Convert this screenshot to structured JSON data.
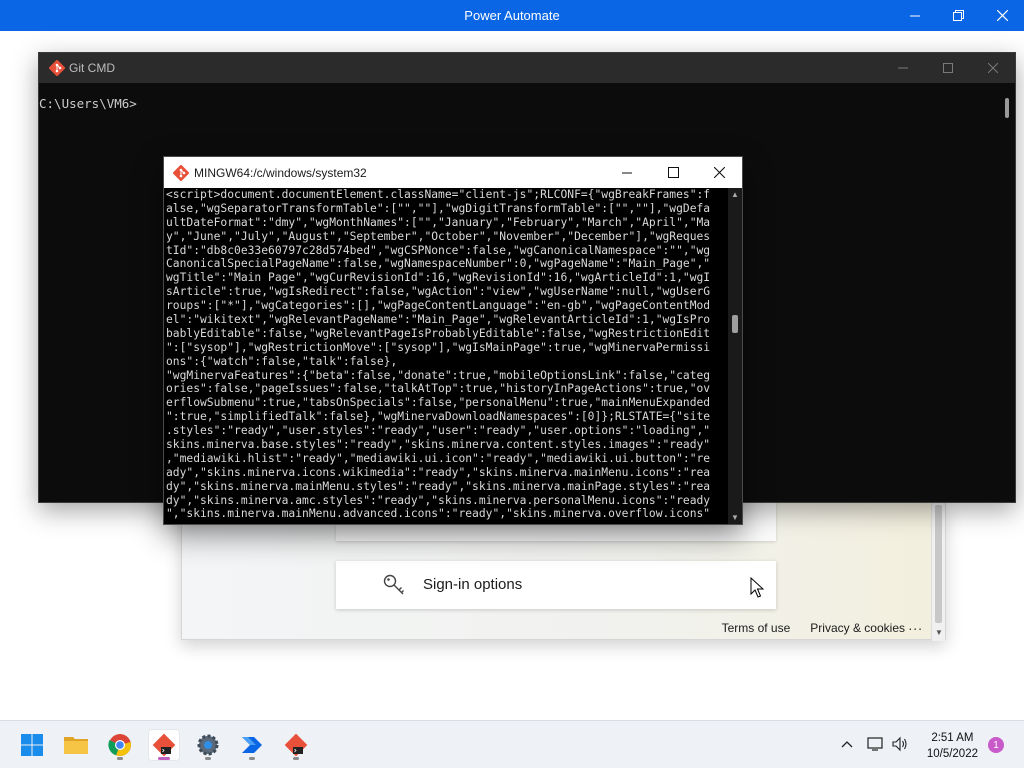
{
  "power_automate": {
    "title": "Power Automate"
  },
  "signin": {
    "options_label": "Sign-in options",
    "footer": {
      "terms": "Terms of use",
      "privacy": "Privacy & cookies",
      "more": "..."
    }
  },
  "gitcmd": {
    "title": "Git CMD",
    "prompt": "C:\\Users\\VM6>"
  },
  "mingw": {
    "title": "MINGW64:/c/windows/system32",
    "lines": [
      "<script>document.documentElement.className=\"client-js\";RLCONF={\"wgBreakFrames\":f",
      "alse,\"wgSeparatorTransformTable\":[\"\",\"\"],\"wgDigitTransformTable\":[\"\",\"\"],\"wgDefa",
      "ultDateFormat\":\"dmy\",\"wgMonthNames\":[\"\",\"January\",\"February\",\"March\",\"April\",\"Ma",
      "y\",\"June\",\"July\",\"August\",\"September\",\"October\",\"November\",\"December\"],\"wgReques",
      "tId\":\"db8c0e33e60797c28d574bed\",\"wgCSPNonce\":false,\"wgCanonicalNamespace\":\"\",\"wg",
      "CanonicalSpecialPageName\":false,\"wgNamespaceNumber\":0,\"wgPageName\":\"Main_Page\",\"",
      "wgTitle\":\"Main Page\",\"wgCurRevisionId\":16,\"wgRevisionId\":16,\"wgArticleId\":1,\"wgI",
      "sArticle\":true,\"wgIsRedirect\":false,\"wgAction\":\"view\",\"wgUserName\":null,\"wgUserG",
      "roups\":[\"*\"],\"wgCategories\":[],\"wgPageContentLanguage\":\"en-gb\",\"wgPageContentMod",
      "el\":\"wikitext\",\"wgRelevantPageName\":\"Main_Page\",\"wgRelevantArticleId\":1,\"wgIsPro",
      "bablyEditable\":false,\"wgRelevantPageIsProbablyEditable\":false,\"wgRestrictionEdit",
      "\":[\"sysop\"],\"wgRestrictionMove\":[\"sysop\"],\"wgIsMainPage\":true,\"wgMinervaPermissi",
      "ons\":{\"watch\":false,\"talk\":false},",
      "\"wgMinervaFeatures\":{\"beta\":false,\"donate\":true,\"mobileOptionsLink\":false,\"categ",
      "ories\":false,\"pageIssues\":false,\"talkAtTop\":true,\"historyInPageActions\":true,\"ov",
      "erflowSubmenu\":true,\"tabsOnSpecials\":false,\"personalMenu\":true,\"mainMenuExpanded",
      "\":true,\"simplifiedTalk\":false},\"wgMinervaDownloadNamespaces\":[0]};RLSTATE={\"site",
      ".styles\":\"ready\",\"user.styles\":\"ready\",\"user\":\"ready\",\"user.options\":\"loading\",\"",
      "skins.minerva.base.styles\":\"ready\",\"skins.minerva.content.styles.images\":\"ready\"",
      ",\"mediawiki.hlist\":\"ready\",\"mediawiki.ui.icon\":\"ready\",\"mediawiki.ui.button\":\"re",
      "ady\",\"skins.minerva.icons.wikimedia\":\"ready\",\"skins.minerva.mainMenu.icons\":\"rea",
      "dy\",\"skins.minerva.mainMenu.styles\":\"ready\",\"skins.minerva.mainPage.styles\":\"rea",
      "dy\",\"skins.minerva.amc.styles\":\"ready\",\"skins.minerva.personalMenu.icons\":\"ready",
      "\",\"skins.minerva.mainMenu.advanced.icons\":\"ready\",\"skins.minerva.overflow.icons\""
    ]
  },
  "taskbar": {
    "time": "2:51 AM",
    "date": "10/5/2022",
    "notification_count": "1"
  },
  "icons": {
    "start": "windows-start-icon",
    "file_explorer": "folder-icon",
    "chrome": "chrome-icon",
    "git": "git-icon",
    "settings": "gear-icon",
    "power_automate": "power-automate-icon"
  }
}
